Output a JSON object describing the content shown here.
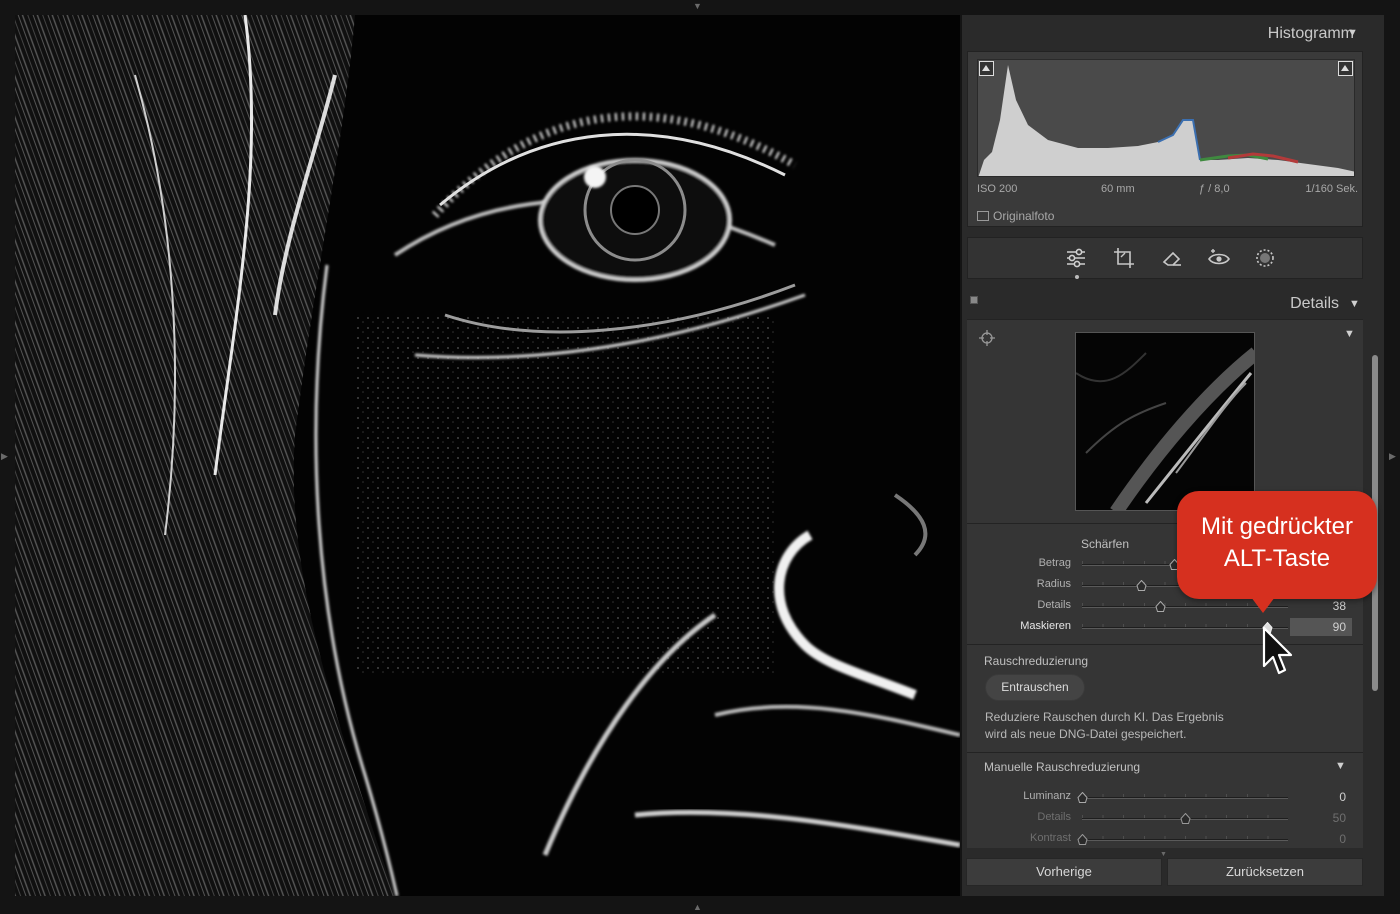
{
  "histogram": {
    "title": "Histogramm",
    "exif": {
      "iso": "ISO 200",
      "focal": "60 mm",
      "aperture": "ƒ / 8,0",
      "shutter": "1/160 Sek."
    },
    "original_photo_label": "Originalfoto"
  },
  "toolbar": {
    "tools": [
      "sliders-icon",
      "crop-icon",
      "eraser-icon",
      "red-eye-icon",
      "mask-icon"
    ],
    "active_tool": "sliders-icon"
  },
  "details": {
    "title": "Details",
    "sharpen": {
      "title": "Schärfen",
      "sliders": [
        {
          "label": "Betrag",
          "value": "",
          "position": 0.45
        },
        {
          "label": "Radius",
          "value": "",
          "position": 0.29
        },
        {
          "label": "Details",
          "value": "38",
          "position": 0.38
        },
        {
          "label": "Maskieren",
          "value": "90",
          "position": 0.9
        }
      ]
    },
    "noise_reduction": {
      "title": "Rauschreduzierung",
      "button_label": "Entrauschen",
      "description_line1": "Reduziere Rauschen durch KI. Das Ergebnis",
      "description_line2": "wird als neue DNG-Datei gespeichert."
    },
    "manual_noise_reduction": {
      "title": "Manuelle Rauschreduzierung",
      "sliders": [
        {
          "label": "Luminanz",
          "value": "0",
          "position": 0.0
        },
        {
          "label": "Details",
          "value": "50",
          "position": 0.5
        },
        {
          "label": "Kontrast",
          "value": "0",
          "position": 0.0
        }
      ]
    }
  },
  "buttons": {
    "previous": "Vorherige",
    "reset": "Zurücksetzen"
  },
  "callout": {
    "line1": "Mit gedrückter",
    "line2": "ALT-Taste"
  },
  "colors": {
    "accent_callout": "#d6301f",
    "panel_bg": "#2a2a2a",
    "app_bg": "#141414"
  }
}
